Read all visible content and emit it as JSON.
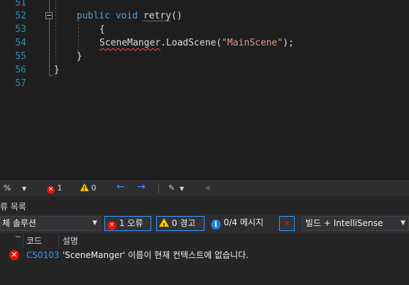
{
  "editor": {
    "lines": [
      {
        "num": "51"
      },
      {
        "num": "52"
      },
      {
        "num": "53"
      },
      {
        "num": "54"
      },
      {
        "num": "55"
      },
      {
        "num": "56"
      },
      {
        "num": "57"
      }
    ],
    "kw_public": "public",
    "kw_void": "void",
    "method_name": "retry",
    "method_parens": "()",
    "open_brace": "{",
    "class_name": "SceneManger",
    "call_rest": ".LoadScene(",
    "string_arg": "\"MainScene\"",
    "call_end": ");",
    "close_brace_inner": "}",
    "close_brace_outer": "}"
  },
  "statusbar": {
    "zoom": "%",
    "error_count": "1",
    "warning_count": "0",
    "nav_back": "←",
    "nav_forward": "→"
  },
  "errorlist": {
    "title": "류 목록",
    "scope": "체 솔루션",
    "errors_btn": "1 오류",
    "warnings_btn": "0 경고",
    "messages_btn": "0/4 메시지",
    "build_filter": "빌드 + IntelliSense",
    "col_code": "코드",
    "col_desc": "설명",
    "rows": [
      {
        "code": "CS0103",
        "description": "'SceneManger' 이름이 현재 컨텍스트에 없습니다."
      }
    ]
  },
  "colors": {
    "editor_bg": "#1e1e1e",
    "keyword": "#569cd6",
    "string": "#d69d85",
    "line_number": "#2b91af",
    "error": "#e51400",
    "link": "#3794ff"
  }
}
